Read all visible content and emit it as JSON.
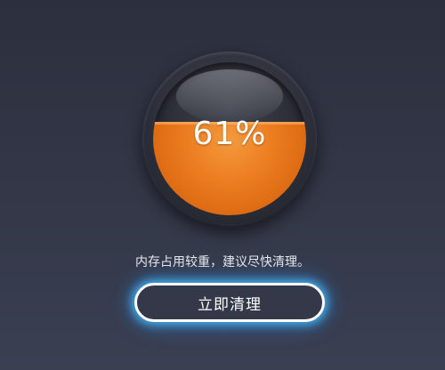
{
  "memory_gauge": {
    "percent_label": "61%",
    "usage_fraction": 0.61,
    "fill_color": "#ec7d20"
  },
  "status": {
    "message": "内存占用较重，建议尽快清理。"
  },
  "actions": {
    "clean_label": "立即清理"
  },
  "colors": {
    "background": "#323646",
    "button_glow": "#46beff",
    "button_border": "#ffffff"
  }
}
